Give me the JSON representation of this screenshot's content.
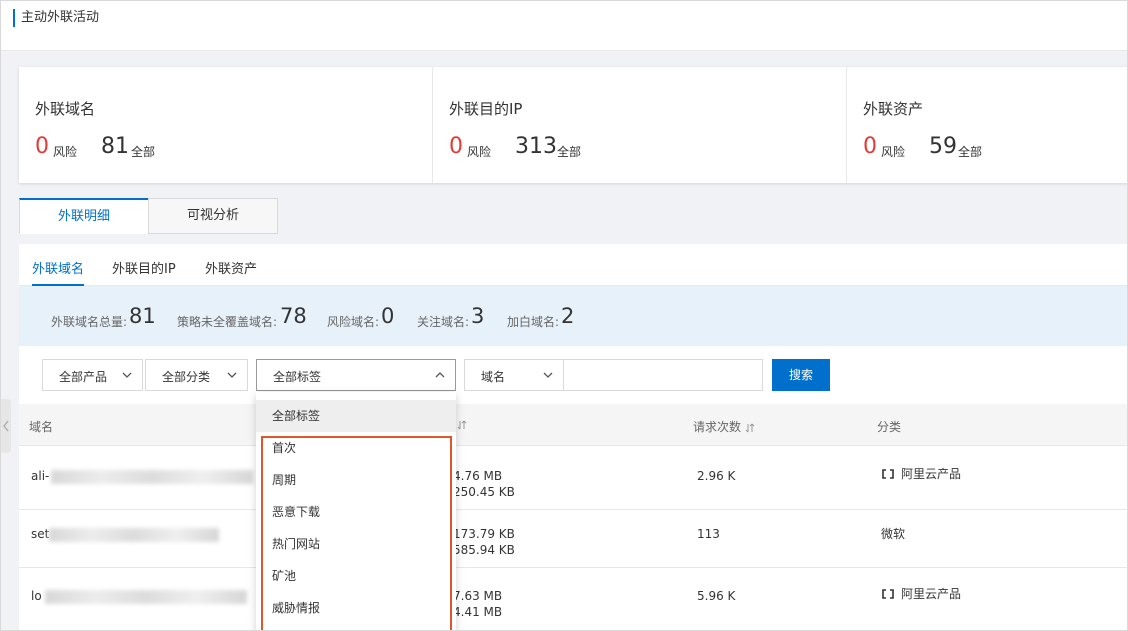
{
  "header": {
    "title": "主动外联活动"
  },
  "summary": [
    {
      "label": "外联域名",
      "risk": "0",
      "risk_text": "风险",
      "all": "81",
      "all_text": "全部"
    },
    {
      "label": "外联目的IP",
      "risk": "0",
      "risk_text": "风险",
      "all": "313",
      "all_text": "全部"
    },
    {
      "label": "外联资产",
      "risk": "0",
      "risk_text": "风险",
      "all": "59",
      "all_text": "全部"
    }
  ],
  "main_tabs": [
    {
      "label": "外联明细",
      "active": true
    },
    {
      "label": "可视分析",
      "active": false
    }
  ],
  "sub_tabs": [
    {
      "label": "外联域名",
      "active": true
    },
    {
      "label": "外联目的IP"
    },
    {
      "label": "外联资产"
    }
  ],
  "metrics": [
    {
      "label": "外联域名总量:",
      "value": "81"
    },
    {
      "label": "策略未全覆盖域名:",
      "value": "78"
    },
    {
      "label": "风险域名:",
      "value": "0"
    },
    {
      "label": "关注域名:",
      "value": "3"
    },
    {
      "label": "加白域名:",
      "value": "2"
    }
  ],
  "filters": {
    "product": "全部产品",
    "category": "全部分类",
    "tag": "全部标签",
    "field": "域名",
    "search_value": "",
    "search_button": "搜索"
  },
  "table": {
    "columns": [
      "域名",
      "请求次数",
      "分类"
    ],
    "rows": [
      {
        "domain": "ali-",
        "traffic_1": "4.76 MB",
        "traffic_2": "250.45 KB",
        "requests": "2.96 K",
        "category": "阿里云产品",
        "category_icon": "link-icon"
      },
      {
        "domain": "set",
        "traffic_1": "173.79 KB",
        "traffic_2": "585.94 KB",
        "requests": "113",
        "category": "微软",
        "category_icon": ""
      },
      {
        "domain": "lo",
        "traffic_1": "7.63 MB",
        "traffic_2": "4.41 MB",
        "requests": "5.96 K",
        "category": "阿里云产品",
        "category_icon": "link-icon"
      }
    ]
  },
  "tag_dropdown": {
    "options": [
      "全部标签",
      "首次",
      "周期",
      "恶意下载",
      "热门网站",
      "矿池",
      "威胁情报"
    ],
    "selected_index": 0
  },
  "colors": {
    "accent": "#0070cc",
    "risk": "#e13c39",
    "highlight_border": "#e0562a"
  }
}
